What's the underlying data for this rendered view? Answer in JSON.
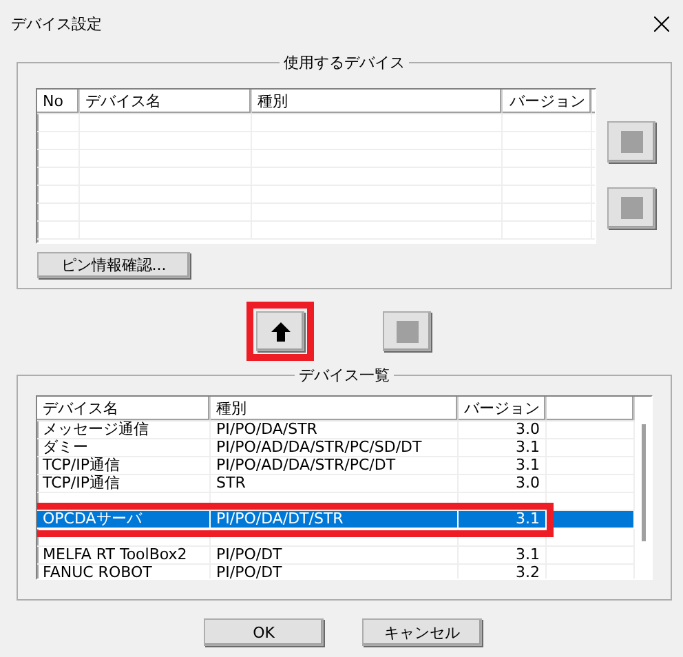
{
  "window": {
    "title": "デバイス設定"
  },
  "used_devices": {
    "title": "使用するデバイス",
    "columns": [
      "No",
      "デバイス名",
      "種別",
      "バージョン"
    ],
    "pin_button": "ピン情報確認..."
  },
  "move_buttons": [
    {
      "kind": "arrow",
      "highlighted": true
    },
    {
      "kind": "square",
      "highlighted": false
    }
  ],
  "device_list": {
    "title": "デバイス一覧",
    "columns": [
      "デバイス名",
      "種別",
      "バージョン"
    ],
    "rows": [
      {
        "name": "メッセージ通信",
        "type": "PI/PO/DA/STR",
        "version": "3.0",
        "selected": false,
        "highlighted": false
      },
      {
        "name": "ダミー",
        "type": "PI/PO/AD/DA/STR/PC/SD/DT",
        "version": "3.1",
        "selected": false,
        "highlighted": false
      },
      {
        "name": "TCP/IP通信",
        "type": "PI/PO/AD/DA/STR/PC/DT",
        "version": "3.1",
        "selected": false,
        "highlighted": false
      },
      {
        "name": "TCP/IP通信",
        "type": "STR",
        "version": "3.0",
        "selected": false,
        "highlighted": false
      },
      {
        "selected": false,
        "highlighted": false
      },
      {
        "name": "OPCDAサーバ",
        "type": "PI/PO/DA/DT/STR",
        "version": "3.1",
        "selected": true,
        "highlighted": true
      },
      {
        "selected": false,
        "highlighted": false
      },
      {
        "name": "MELFA RT ToolBox2",
        "type": "PI/PO/DT",
        "version": "3.1",
        "selected": false,
        "highlighted": false
      },
      {
        "name": "FANUC ROBOT",
        "type": "PI/PO/DT",
        "version": "3.2",
        "selected": false,
        "highlighted": false
      }
    ]
  },
  "buttons": [
    "OK",
    "キャンセル"
  ]
}
